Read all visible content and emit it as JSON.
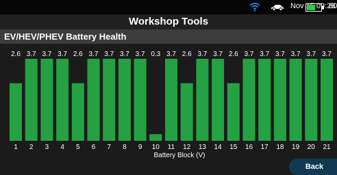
{
  "status_bar": {
    "wifi_icon": "wifi-icon",
    "vehicle_icon": "car-icon",
    "date_time": "Nov 15  09:28 AM",
    "battery_icon": "battery-icon",
    "battery_level_fraction": 0.6,
    "battery_percent": "60%"
  },
  "app": {
    "title": "Workshop Tools"
  },
  "section": {
    "title": "EV/HEV/PHEV Battery Health"
  },
  "colors": {
    "bar": "#24a142",
    "background": "#1b1b1b",
    "accent": "#0f3a52"
  },
  "chart_data": {
    "type": "bar",
    "categories": [
      "1",
      "2",
      "3",
      "4",
      "5",
      "6",
      "7",
      "8",
      "9",
      "10",
      "11",
      "12",
      "13",
      "14",
      "15",
      "16",
      "17",
      "18",
      "19",
      "20",
      "21"
    ],
    "values": [
      2.6,
      3.7,
      3.7,
      3.7,
      2.6,
      3.7,
      3.7,
      3.7,
      3.7,
      0.3,
      3.7,
      2.6,
      3.7,
      3.7,
      2.6,
      3.7,
      3.7,
      3.7,
      3.7,
      3.7,
      3.7
    ],
    "value_labels": [
      "2.6",
      "3.7",
      "3.7",
      "3.7",
      "2.6",
      "3.7",
      "3.7",
      "3.7",
      "3.7",
      "0.3",
      "3.7",
      "2.6",
      "3.7",
      "3.7",
      "2.6",
      "3.7",
      "3.7",
      "3.7",
      "3.7",
      "3.7",
      "3.7"
    ],
    "xlabel": "Battery Block (V)",
    "ylabel": "",
    "ylim": [
      0,
      3.7
    ],
    "grid": false,
    "legend": "none"
  },
  "actions": {
    "back_label": "Back"
  }
}
